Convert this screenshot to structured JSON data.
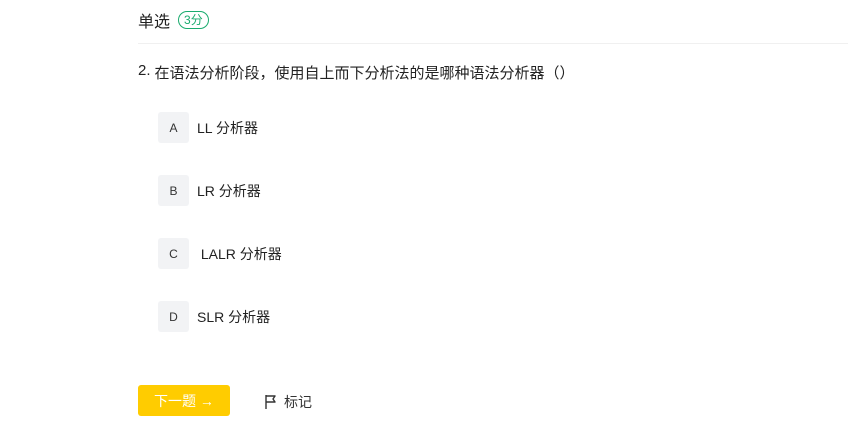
{
  "header": {
    "type_label": "单选",
    "score": "3分"
  },
  "question": {
    "number": "2.",
    "text": "在语法分析阶段，使用自上而下分析法的是哪种语法分析器（）"
  },
  "options": [
    {
      "key": "A",
      "text": "LL 分析器"
    },
    {
      "key": "B",
      "text": "LR 分析器"
    },
    {
      "key": "C",
      "text": " LALR 分析器"
    },
    {
      "key": "D",
      "text": "SLR 分析器"
    }
  ],
  "actions": {
    "next_label": "下一题 →",
    "mark_label": "标记",
    "mark_icon": "flag-icon"
  },
  "colors": {
    "accent": "#ffcc00",
    "badge": "#1aab6e",
    "option_key_bg": "#f2f3f5"
  }
}
